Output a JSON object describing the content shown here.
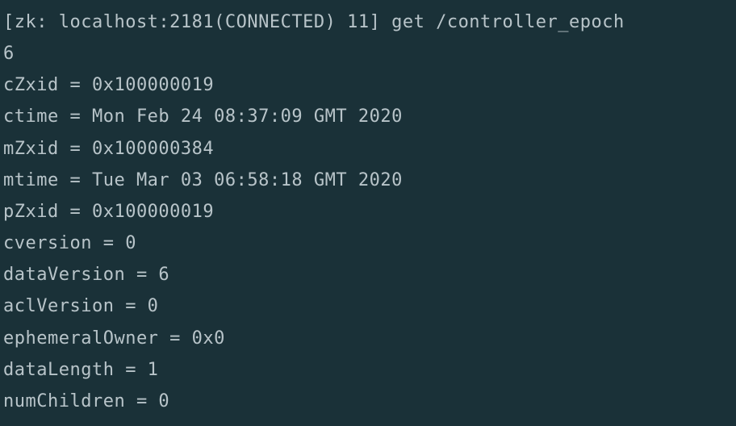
{
  "prompt": {
    "prefix": "[zk: localhost:2181(CONNECTED) 11] ",
    "command": "get /controller_epoch"
  },
  "output": {
    "value": "6",
    "cZxid": "cZxid = 0x100000019",
    "ctime": "ctime = Mon Feb 24 08:37:09 GMT 2020",
    "mZxid": "mZxid = 0x100000384",
    "mtime": "mtime = Tue Mar 03 06:58:18 GMT 2020",
    "pZxid": "pZxid = 0x100000019",
    "cversion": "cversion = 0",
    "dataVersion": "dataVersion = 6",
    "aclVersion": "aclVersion = 0",
    "ephemeralOwner": "ephemeralOwner = 0x0",
    "dataLength": "dataLength = 1",
    "numChildren": "numChildren = 0"
  }
}
